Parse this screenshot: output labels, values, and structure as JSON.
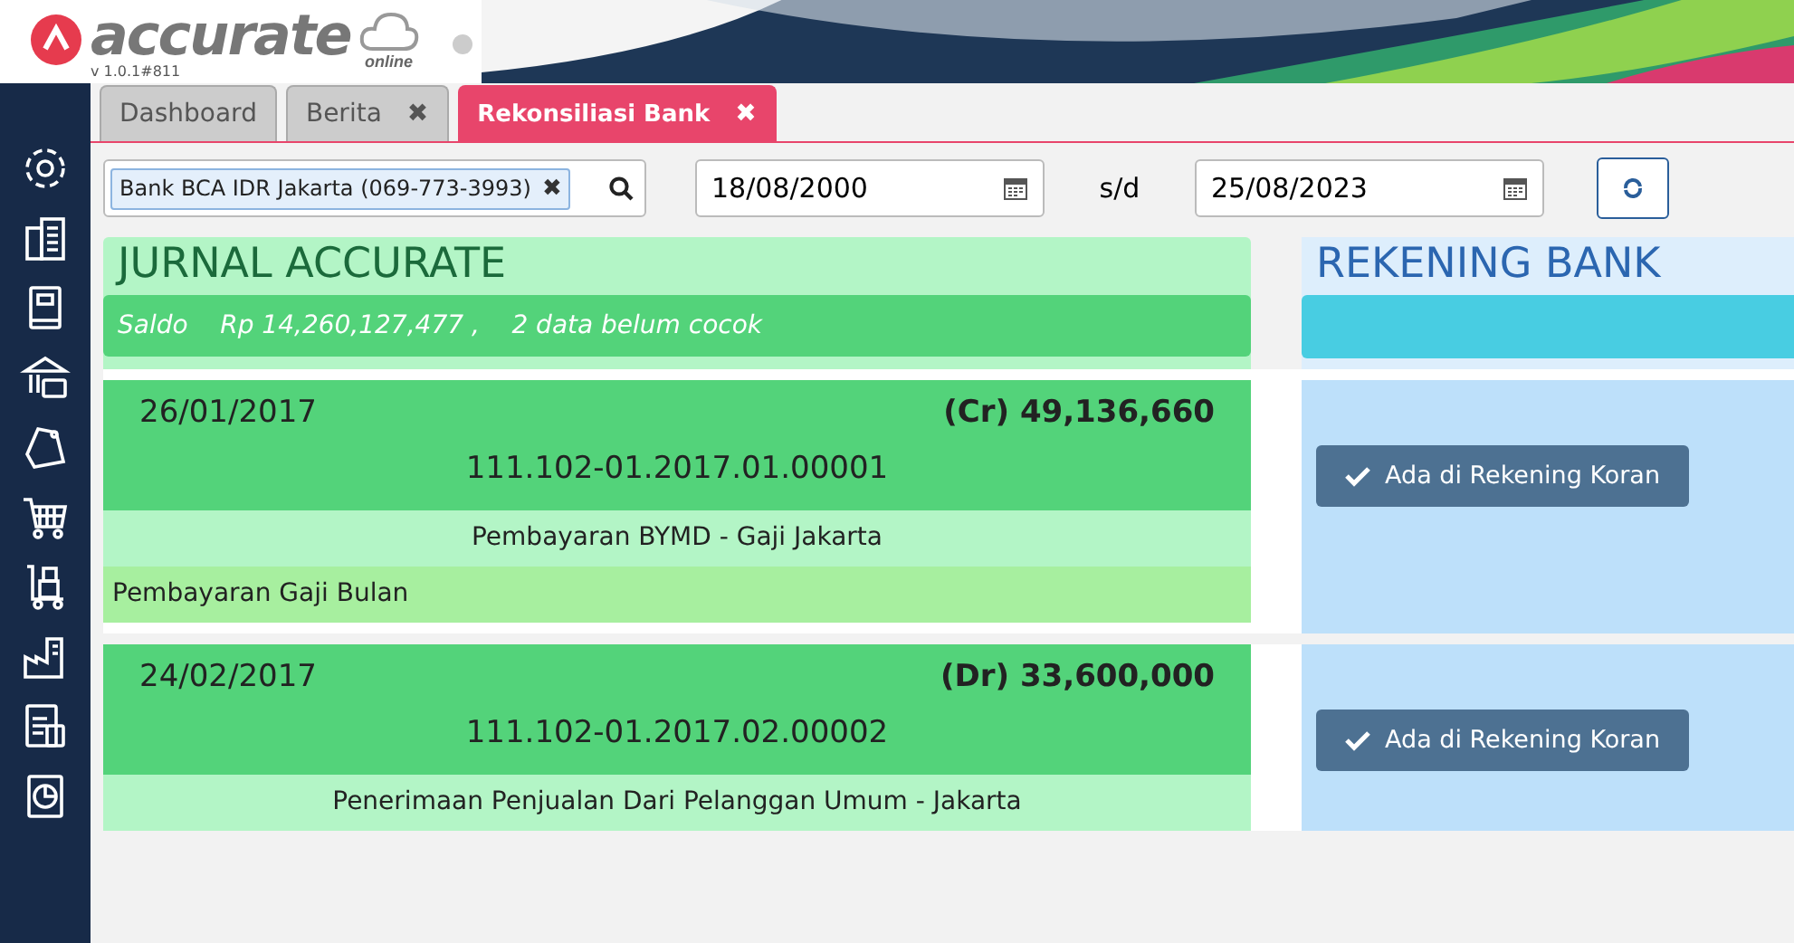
{
  "app": {
    "logo": "accurate",
    "logo_sub": "online",
    "version": "v 1.0.1#811"
  },
  "tabs": [
    {
      "label": "Dashboard",
      "selected": false,
      "closable": false
    },
    {
      "label": "Berita",
      "selected": false,
      "closable": true
    },
    {
      "label": "Rekonsiliasi Bank",
      "selected": true,
      "closable": true
    }
  ],
  "close_glyph": "✖",
  "filter": {
    "account": "Bank BCA IDR Jakarta (069-773-3993)",
    "date_from": "18/08/2000",
    "separator": "s/d",
    "date_to": "25/08/2023"
  },
  "jurnal": {
    "title": "JURNAL ACCURATE",
    "summary": "Saldo    Rp 14,260,127,477 ,    2 data belum cocok"
  },
  "rekening": {
    "title": "REKENING BANK"
  },
  "entries": [
    {
      "date": "26/01/2017",
      "amount": "(Cr) 49,136,660",
      "number": "111.102-01.2017.01.00001",
      "description": "Pembayaran BYMD - Gaji Jakarta",
      "note": "Pembayaran Gaji Bulan",
      "action": "Ada di Rekening Koran"
    },
    {
      "date": "24/02/2017",
      "amount": "(Dr) 33,600,000",
      "number": "111.102-01.2017.02.00002",
      "description": "Penerimaan Penjualan Dari Pelanggan Umum - Jakarta",
      "action": "Ada di Rekening Koran"
    }
  ]
}
